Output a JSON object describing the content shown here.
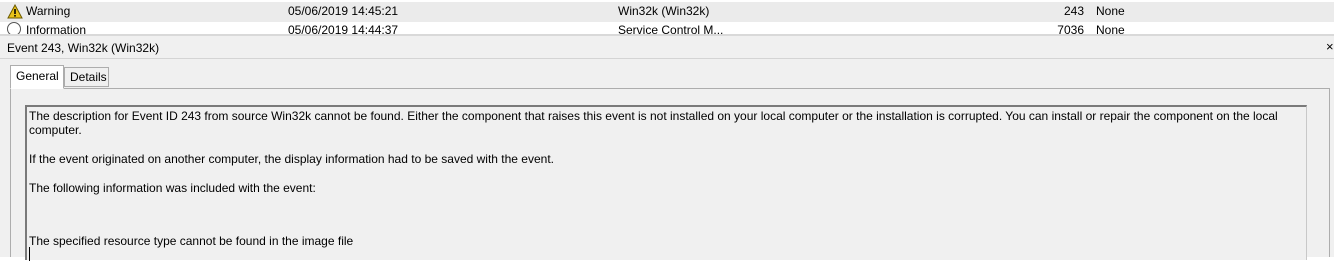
{
  "event_list": {
    "rows": [
      {
        "level": "Warning",
        "date_time": "05/06/2019 14:45:21",
        "source": "Win32k (Win32k)",
        "event_id": "243",
        "task_category": "None",
        "icon": "warning-icon"
      },
      {
        "level": "Information",
        "date_time": "05/06/2019 14:44:37",
        "source": "Service Control M...",
        "event_id": "7036",
        "task_category": "None",
        "icon": "info-icon"
      }
    ]
  },
  "detail": {
    "title": "Event 243, Win32k (Win32k)",
    "close_glyph": "×",
    "tabs": [
      {
        "label": "General",
        "active": true
      },
      {
        "label": "Details",
        "active": false
      }
    ],
    "description": {
      "p1": "The description for Event ID 243 from source Win32k cannot be found. Either the component that raises this event is not installed on your local computer or the installation is corrupted. You can install or repair the component on the local computer.",
      "p2": "If the event originated on another computer, the display information had to be saved with the event.",
      "p3": "The following information was included with the event:",
      "p4": "The specified resource type cannot be found in the image file"
    }
  },
  "colors": {
    "selected_row": "#ebebeb",
    "pane_background": "#f0f0f0",
    "warning_icon": "#e8c21a"
  }
}
